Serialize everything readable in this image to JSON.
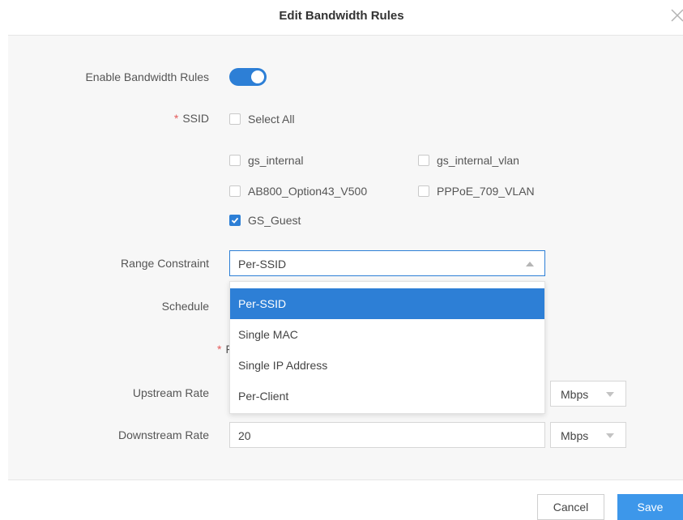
{
  "dialog": {
    "title": "Edit Bandwidth Rules",
    "close_icon": "close-icon"
  },
  "form": {
    "enable_label": "Enable Bandwidth Rules",
    "enable_value": true,
    "ssid_required_mark": "*",
    "ssid_label": "SSID",
    "select_all_label": "Select All",
    "ssids": [
      {
        "label": "gs_internal",
        "checked": false
      },
      {
        "label": "gs_internal_vlan",
        "checked": false
      },
      {
        "label": "AB800_Option43_V500",
        "checked": false
      },
      {
        "label": "PPPoE_709_VLAN",
        "checked": false
      },
      {
        "label": "GS_Guest",
        "checked": true
      }
    ],
    "range_label": "Range Constraint",
    "range_value": "Per-SSID",
    "range_options": [
      "Per-SSID",
      "Single MAC",
      "Single IP Address",
      "Per-Client"
    ],
    "schedule_label": "Schedule",
    "hidden_required_mark": "*",
    "hidden_label_fragment": "F",
    "upstream_label": "Upstream Rate",
    "upstream_unit": "Mbps",
    "downstream_label": "Downstream Rate",
    "downstream_value": "20",
    "downstream_unit": "Mbps"
  },
  "footer": {
    "cancel_label": "Cancel",
    "save_label": "Save"
  },
  "colors": {
    "accent": "#2d7fd6",
    "required": "#e45a5a",
    "save_button": "#3d97ea"
  }
}
